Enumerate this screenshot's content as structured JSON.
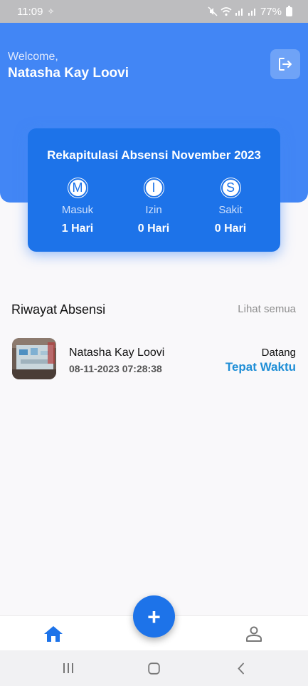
{
  "status_bar": {
    "time": "11:09",
    "battery": "77%"
  },
  "header": {
    "welcome": "Welcome,",
    "user_name": "Natasha Kay Loovi"
  },
  "summary": {
    "title": "Rekapitulasi Absensi November 2023",
    "stats": [
      {
        "letter": "M",
        "label": "Masuk",
        "value": "1 Hari"
      },
      {
        "letter": "I",
        "label": "Izin",
        "value": "0 Hari"
      },
      {
        "letter": "S",
        "label": "Sakit",
        "value": "0 Hari"
      }
    ]
  },
  "history": {
    "title": "Riwayat Absensi",
    "see_all": "Lihat semua",
    "items": [
      {
        "name": "Natasha Kay Loovi",
        "datetime": "08-11-2023 07:28:38",
        "type": "Datang",
        "status": "Tepat Waktu"
      }
    ]
  },
  "fab": {
    "label": "+"
  },
  "colors": {
    "primary": "#1d73e9",
    "header_bg": "#4286f5",
    "status_on_time": "#1f8ed6"
  },
  "icons": {
    "logout": "logout-icon",
    "home": "home-icon",
    "profile": "person-icon"
  }
}
